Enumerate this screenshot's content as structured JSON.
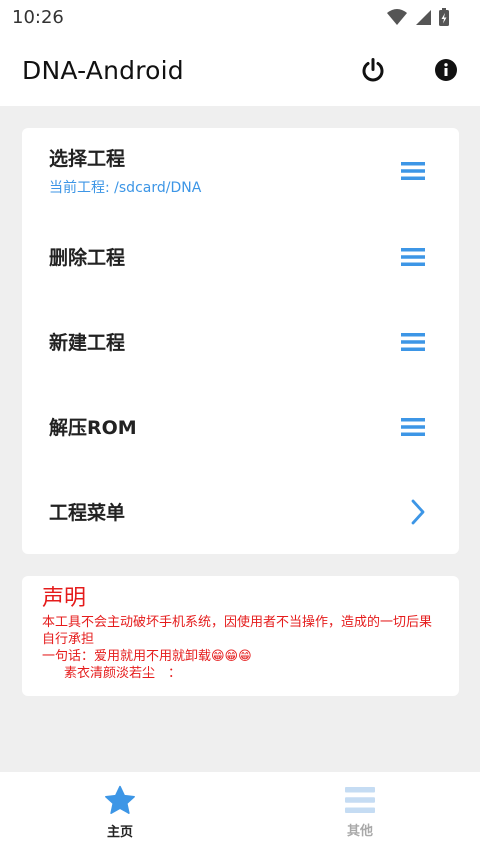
{
  "status_bar": {
    "time": "10:26"
  },
  "app_bar": {
    "title": "DNA-Android"
  },
  "menu": {
    "items": [
      {
        "label": "选择工程",
        "sub": "当前工程: /sdcard/DNA",
        "icon": "menu-lines-icon"
      },
      {
        "label": "删除工程",
        "icon": "menu-lines-icon"
      },
      {
        "label": "新建工程",
        "icon": "menu-lines-icon"
      },
      {
        "label": "解压ROM",
        "icon": "menu-lines-icon"
      },
      {
        "label": "工程菜单",
        "icon": "chevron-right-icon"
      }
    ]
  },
  "notice": {
    "title": "声明",
    "body": "本工具不会主动破坏手机系统，因使用者不当操作，造成的一切后果自行承担",
    "slogan": "一句话：爱用就用不用就卸载😁😁😁",
    "sign": "素衣清颜淡若尘　："
  },
  "bottom_nav": {
    "home": "主页",
    "other": "其他"
  },
  "colors": {
    "accent": "#3d96e6",
    "warning": "#e51c1c"
  }
}
